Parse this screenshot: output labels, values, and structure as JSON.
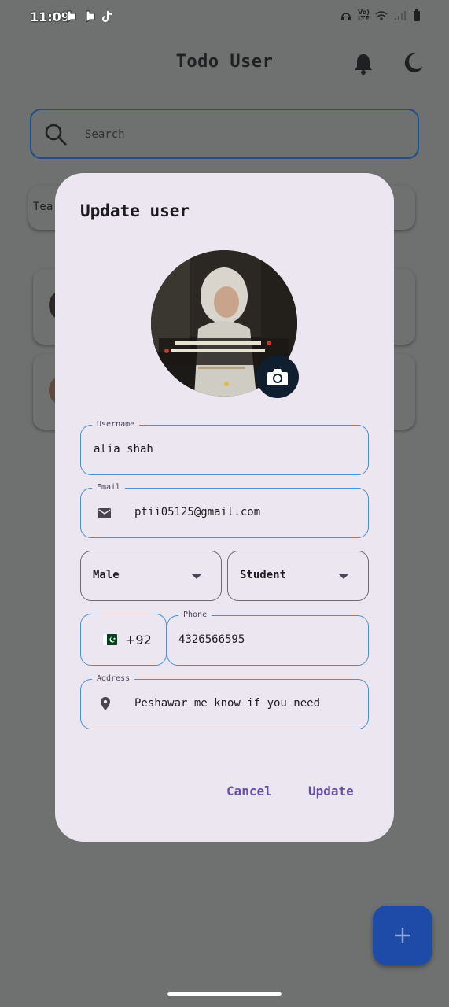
{
  "status_bar": {
    "time": "11:09",
    "network": "Vo) LTE"
  },
  "app": {
    "title": "Todo User",
    "search_placeholder": "Search",
    "tab_partial_label": "Tea"
  },
  "dialog": {
    "title": "Update user",
    "username": {
      "label": "Username",
      "value": "alia shah"
    },
    "email": {
      "label": "Email",
      "value": "ptii05125@gmail.com"
    },
    "gender": {
      "selected": "Male"
    },
    "role": {
      "selected": "Student"
    },
    "phone": {
      "country_code": "+92",
      "label": "Phone",
      "value": "4326566595"
    },
    "address": {
      "label": "Address",
      "value": "Peshawar me know if you need"
    },
    "cancel_label": "Cancel",
    "update_label": "Update"
  },
  "colors": {
    "accent": "#6750a4",
    "field_border": "#4a90d9",
    "dialog_bg": "#ece6f1",
    "fab": "#1e4aa8"
  }
}
